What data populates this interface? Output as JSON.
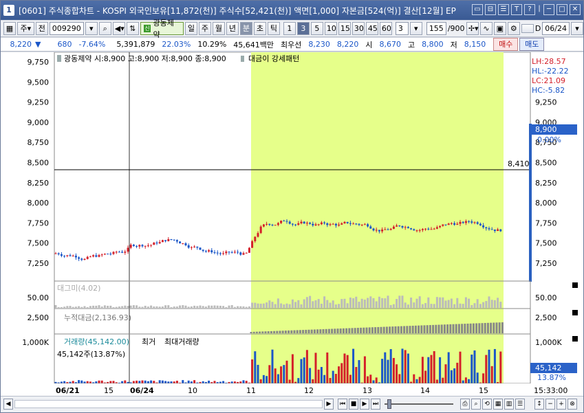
{
  "window": {
    "app_icon": "1",
    "title": "[0601] 주식종합차트 - KOSPI 외국인보유[11,872(천)] 주식수[52,421(천)] 액면[1,000] 자본금[524(억)] 결산[12월] EP",
    "controls": [
      "▭",
      "⊟",
      "☰",
      "T",
      "?",
      "|",
      "─",
      "□",
      "✕"
    ]
  },
  "toolbar1": {
    "period_select": "주",
    "prev_button": "전",
    "code_input": "009290",
    "company_tag_badge": "신",
    "company_name": "광동제약",
    "period_buttons": [
      "일",
      "주",
      "월",
      "년",
      "분",
      "초",
      "틱"
    ],
    "selected_period": "분",
    "interval_buttons": [
      "1",
      "3",
      "5",
      "10",
      "15",
      "30",
      "45",
      "60"
    ],
    "selected_interval": "3",
    "interval_select": "3",
    "count_input": "155",
    "count_total": "/900",
    "date_checkbox_label": "D",
    "date_input": "06/24"
  },
  "quote": {
    "price": "8,220",
    "change": "680",
    "change_pct": "-7.64%",
    "volume": "5,391,879",
    "vol_ratio1": "22.03%",
    "vol_ratio2": "10.29%",
    "amount": "45,641백만",
    "best_ask_label": "최우선",
    "best_ask1": "8,230",
    "best_ask2": "8,220",
    "open_label": "시",
    "open": "8,670",
    "high_label": "고",
    "high": "8,800",
    "low_label": "저",
    "low": "8,150",
    "buy_button": "매수",
    "sell_button": "매도"
  },
  "main_panel": {
    "legend_text": "광동제약 시:8,900 고:8,900 저:8,900 종:8,900",
    "pattern_label": "대금이 강세패턴",
    "hline_label": "8,410",
    "right_labels": [
      {
        "text": "LH:28.57",
        "color": "#d4202a"
      },
      {
        "text": "HL:-22.22",
        "color": "#1a56c8"
      },
      {
        "text": "LC:21.09",
        "color": "#d4202a"
      },
      {
        "text": "HC:-5.82",
        "color": "#1a56c8"
      }
    ],
    "y_ticks": [
      "9,750",
      "9,500",
      "9,250",
      "9,000",
      "8,750",
      "8,500",
      "8,250",
      "8,000",
      "7,750",
      "7,500",
      "7,250"
    ],
    "price_badge": "8,900",
    "price_badge_pct": "0.00%"
  },
  "sub_panels": [
    {
      "label": "대그미(4.02)",
      "left_tick": "50.00",
      "right_tick": "50.00"
    },
    {
      "label": "누적대금(2,136.93)",
      "left_tick": "2,500",
      "right_tick": "2,500"
    },
    {
      "label": "거래량(45,142.00)",
      "label2": "최거",
      "label3": "최대거래량",
      "left_tick": "1,000K",
      "right_tick": "1,000K",
      "sub_text": "45,142주(13.87%)",
      "value_badge": "45,142",
      "value_badge_pct": "13.87%"
    }
  ],
  "x_axis": {
    "labels": [
      "06/21",
      "15",
      "06/24",
      "10",
      "11",
      "12",
      "13",
      "14",
      "15"
    ],
    "time": "15:33:00"
  },
  "colors": {
    "up": "#d4202a",
    "down": "#1a56c8",
    "highlight": "#e6ff8a",
    "title_bar": "#3f609b"
  }
}
